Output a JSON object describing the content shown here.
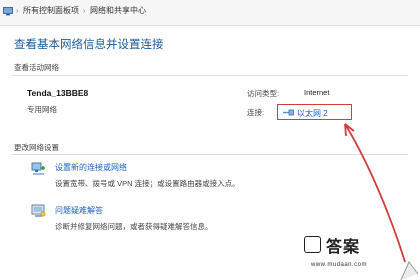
{
  "breadcrumb": {
    "items": [
      "所有控制面板项",
      "网络和共享中心"
    ]
  },
  "page_title": "查看基本网络信息并设置连接",
  "active_networks": {
    "section_label": "查看活动网络",
    "network_name": "Tenda_13BBE8",
    "network_type": "专用网络",
    "access_type_label": "访问类型:",
    "access_type_value": "Internet",
    "connections_label": "连接:",
    "connection_name": "以太网 2"
  },
  "change_settings": {
    "section_label": "更改网络设置",
    "tasks": [
      {
        "icon": "network-setup-icon",
        "title": "设置新的连接或网络",
        "description": "设置宽带、拨号或 VPN 连接；或设置路由器或接入点。"
      },
      {
        "icon": "troubleshoot-icon",
        "title": "问题疑难解答",
        "description": "诊断并修复网络问题，或者获得疑难解答信息。"
      }
    ]
  },
  "watermark": {
    "text": "答案",
    "url": "www.mudaan.com"
  },
  "colors": {
    "link": "#1a62c5",
    "title": "#1c5b99",
    "annotation": "#d23c3c"
  }
}
